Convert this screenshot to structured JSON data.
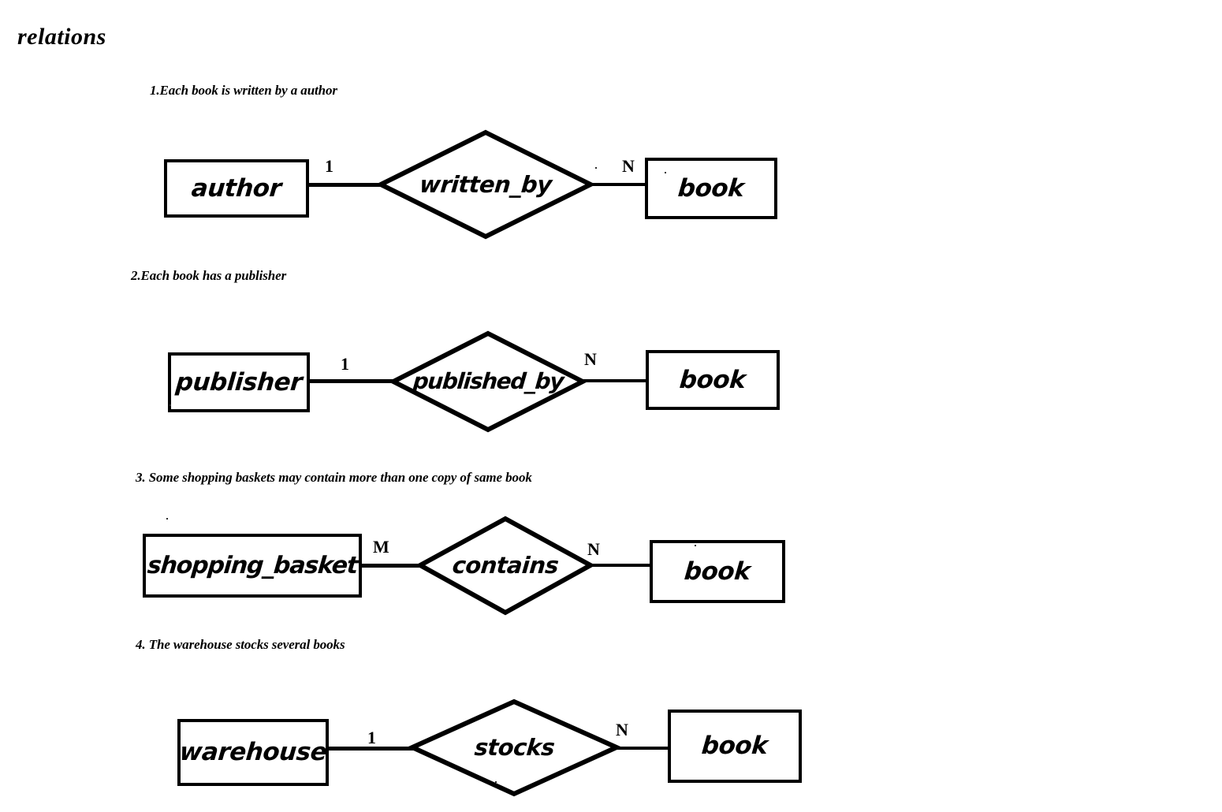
{
  "document": {
    "title": "relations",
    "background_color": "#ffffff",
    "stroke_color": "#000000"
  },
  "diagrams": [
    {
      "caption": "1.Each book is written by a author",
      "left_entity": "author",
      "relationship": "written_by",
      "right_entity": "book",
      "left_cardinality": "1",
      "right_cardinality": "N"
    },
    {
      "caption": "2.Each book has a publisher",
      "left_entity": "publisher",
      "relationship": "published_by",
      "right_entity": "book",
      "left_cardinality": "1",
      "right_cardinality": "N"
    },
    {
      "caption": "3. Some shopping baskets may contain more than one copy of same book",
      "left_entity": "shopping_basket",
      "relationship": "contains",
      "right_entity": "book",
      "left_cardinality": "M",
      "right_cardinality": "N"
    },
    {
      "caption": "4. The warehouse stocks several books",
      "left_entity": "warehouse",
      "relationship": "stocks",
      "right_entity": "book",
      "left_cardinality": "1",
      "right_cardinality": "N"
    }
  ]
}
